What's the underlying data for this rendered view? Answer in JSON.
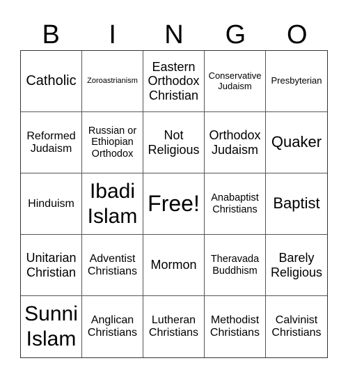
{
  "header": {
    "letters": [
      "B",
      "I",
      "N",
      "G",
      "O"
    ]
  },
  "cells": [
    "Catholic",
    "Zoroastrianism",
    "Eastern Orthodox Christian",
    "Conservative Judaism",
    "Presbyterian",
    "Reformed Judaism",
    "Russian or Ethiopian Orthodox",
    "Not Religious",
    "Orthodox Judaism",
    "Quaker",
    "Hinduism",
    "Ibadi Islam",
    "Free!",
    "Anabaptist Christians",
    "Baptist",
    "Unitarian Christian",
    "Adventist Christians",
    "Mormon",
    "Theravada Buddhism",
    "Barely Religious",
    "Sunni Islam",
    "Anglican Christians",
    "Lutheran Christians",
    "Methodist Christians",
    "Calvinist Christians"
  ]
}
